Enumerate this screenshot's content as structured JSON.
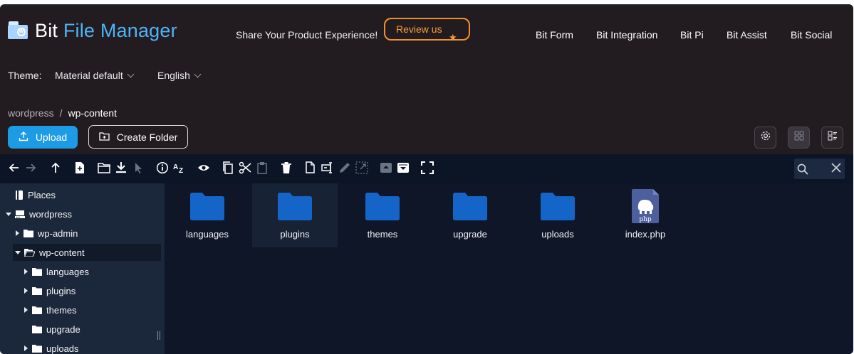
{
  "header": {
    "brand_a": "Bit",
    "brand_b": "File Manager",
    "share_text": "Share Your Product Experience!",
    "review_label": "Review us",
    "nav": [
      "Bit Form",
      "Bit Integration",
      "Bit Pi",
      "Bit Assist",
      "Bit Social"
    ]
  },
  "settings": {
    "theme_label": "Theme:",
    "theme_value": "Material default",
    "language_value": "English"
  },
  "breadcrumb": {
    "root": "wordpress",
    "separator": "/",
    "current": "wp-content"
  },
  "actions": {
    "upload_label": "Upload",
    "create_folder_label": "Create Folder"
  },
  "tree": {
    "places": "Places",
    "root": "wordpress",
    "items": [
      "wp-admin",
      "wp-content",
      "languages",
      "plugins",
      "themes",
      "upgrade",
      "uploads"
    ]
  },
  "files": [
    {
      "name": "languages",
      "icon": "folder-icon"
    },
    {
      "name": "plugins",
      "icon": "folder-icon"
    },
    {
      "name": "themes",
      "icon": "folder-icon"
    },
    {
      "name": "upgrade",
      "icon": "folder-icon"
    },
    {
      "name": "uploads",
      "icon": "folder-icon"
    },
    {
      "name": "index.php",
      "icon": "php-file-icon",
      "badge": "php"
    }
  ],
  "colors": {
    "accent": "#1d9be4",
    "review": "#f39c38",
    "folder": "#1565c8",
    "brand_blue": "#4fb4f5"
  }
}
